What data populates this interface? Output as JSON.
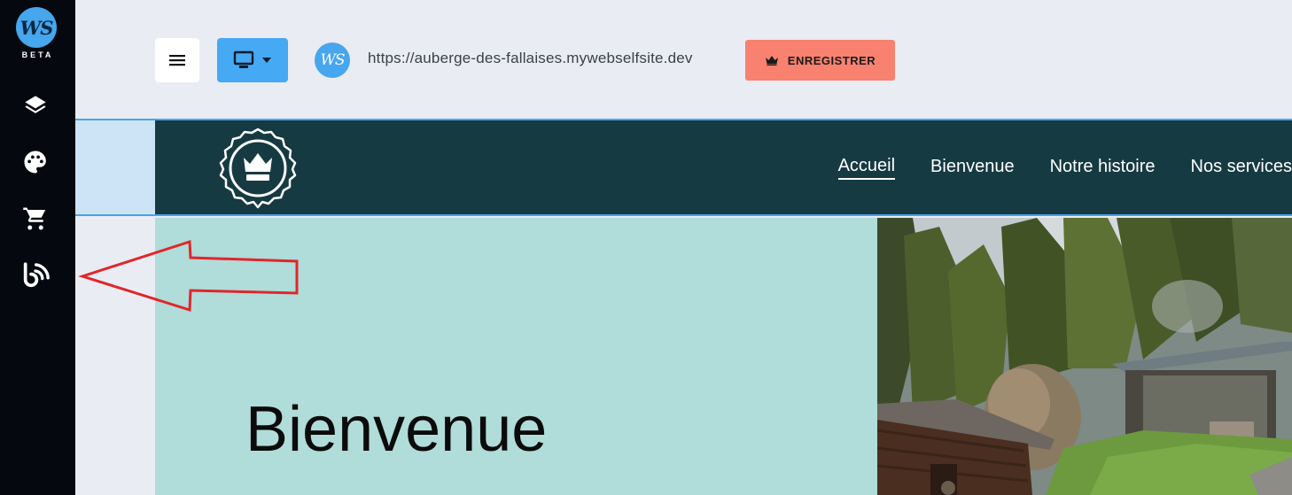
{
  "sidebar": {
    "logo_text": "WS",
    "badge": "BETA",
    "items": [
      {
        "icon": "layers-icon"
      },
      {
        "icon": "palette-icon"
      },
      {
        "icon": "cart-icon"
      },
      {
        "icon": "blog-icon"
      }
    ]
  },
  "toolbar": {
    "site_avatar_text": "WS",
    "url": "https://auberge-des-fallaises.mywebselfsite.dev",
    "save_label": "ENREGISTRER"
  },
  "site": {
    "nav": [
      {
        "label": "Accueil",
        "active": true
      },
      {
        "label": "Bienvenue"
      },
      {
        "label": "Notre histoire"
      },
      {
        "label": "Nos services"
      }
    ],
    "hero_title": "Bienvenue"
  },
  "colors": {
    "sidebar_bg": "#05090f",
    "accent": "#45a9f4",
    "save_button": "#f8816f",
    "site_header": "#163a42",
    "hero_bg": "#b0dcd9",
    "annotation_arrow": "#e0262b"
  }
}
